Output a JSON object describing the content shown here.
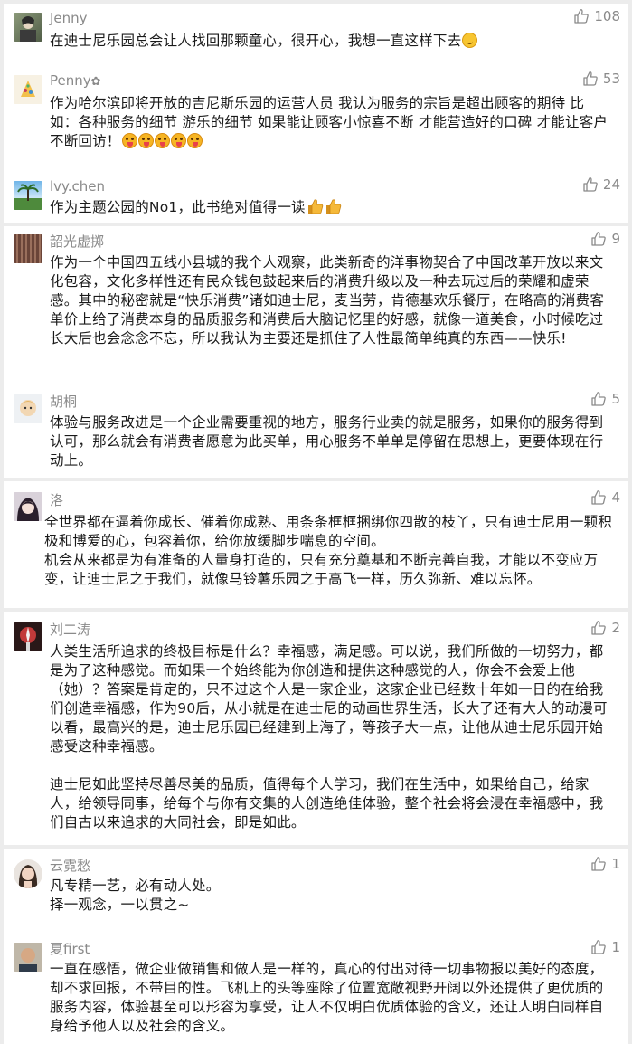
{
  "comments": [
    {
      "name": "Jenny",
      "likes": "108",
      "paragraphs": [
        "在迪士尼乐园总会让人找回那颗童心，很开心，我想一直这样下去"
      ]
    },
    {
      "name": "Penny",
      "likes": "53",
      "paragraphs": [
        "作为哈尔滨即将开放的吉尼斯乐园的运营人员 我认为服务的宗旨是超出顾客的期待 比如：各种服务的细节 游乐的细节 如果能让顾客小惊喜不断 才能营造好的口碑 才能让客户不断回访！"
      ]
    },
    {
      "name": "lvy.chen",
      "likes": "24",
      "paragraphs": [
        "作为主题公园的No1，此书绝对值得一读"
      ]
    },
    {
      "name": "韶光虚掷",
      "likes": "9",
      "paragraphs": [
        "作为一个中国四五线小县城的我个人观察，此类新奇的洋事物契合了中国改革开放以来文化包容，文化多样性还有民众钱包鼓起来后的消费升级以及一种去玩过后的荣耀和虚荣感。其中的秘密就是“快乐消费”诸如迪士尼，麦当劳，肯德基欢乐餐厅，在略高的消费客单价上给了消费本身的品质服务和消费后大脑记忆里的好感，就像一道美食，小时候吃过长大后也会念念不忘，所以我认为主要还是抓住了人性最简单纯真的东西——快乐!"
      ]
    },
    {
      "name": "胡桐",
      "likes": "5",
      "paragraphs": [
        "体验与服务改进是一个企业需要重视的地方，服务行业卖的就是服务，如果你的服务得到认可，那么就会有消费者愿意为此买单，用心服务不单单是停留在思想上，更要体现在行动上。"
      ]
    },
    {
      "name": "洛",
      "likes": "4",
      "paragraphs": [
        "全世界都在逼着你成长、催着你成熟、用条条框框捆绑你四散的枝丫，只有迪士尼用一颗积极和博爱的心，包容着你，给你放缓脚步喘息的空间。",
        "机会从来都是为有准备的人量身打造的，只有充分奠基和不断完善自我，才能以不变应万变，让迪士尼之于我们，就像马铃薯乐园之于高飞一样，历久弥新、难以忘怀。"
      ]
    },
    {
      "name": "刘二涛",
      "likes": "2",
      "paragraphs": [
        "人类生活所追求的终极目标是什么？幸福感，满足感。可以说，我们所做的一切努力，都是为了这种感觉。而如果一个始终能为你创造和提供这种感觉的人，你会不会爱上他（她）？答案是肯定的，只不过这个人是一家企业，这家企业已经数十年如一日的在给我们创造幸福感，作为90后，从小就是在迪士尼的动画世界生活，长大了还有大人的动漫可以看，最高兴的是，迪士尼乐园已经建到上海了，等孩子大一点，让他从迪士尼乐园开始感受这种幸福感。",
        "迪士尼如此坚持尽善尽美的品质，值得每个人学习，我们在生活中，如果给自己，给家人，给领导同事，给每个与你有交集的人创造绝佳体验，整个社会将会浸在幸福感中，我们自古以来追求的大同社会，即是如此。"
      ]
    },
    {
      "name": "云霓愁",
      "likes": "1",
      "paragraphs": [
        "凡专精一艺，必有动人处。",
        "择一观念，一以贯之~"
      ]
    },
    {
      "name": "夏first",
      "likes": "1",
      "paragraphs": [
        "一直在感悟，做企业做销售和做人是一样的，真心的付出对待一切事物报以美好的态度，却不求回报，不带目的性。飞机上的头等座除了位置宽敞视野开阔以外还提供了更优质的服务内容，体验甚至可以形容为享受，让人不仅明白优质体验的含义，还让人明白同样自身给予他人以及社会的含义。"
      ]
    }
  ],
  "icons": {
    "like": "thumb-up-icon",
    "flower": "flower-icon",
    "emoji_smile": "smile-emoji-icon",
    "emoji_tongue": "tongue-out-emoji-icon",
    "thumb": "thumbs-up-emoji-icon"
  },
  "colors": {
    "page": "#ececec",
    "card": "#ffffff",
    "meta": "#8a8a8a",
    "text": "#1a1a1a"
  }
}
